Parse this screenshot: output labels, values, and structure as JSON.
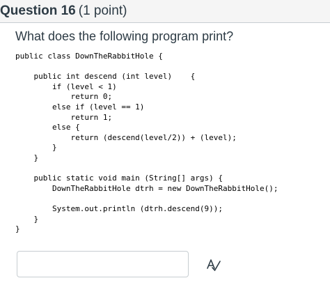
{
  "question": {
    "title": "Question 16",
    "points": "(1 point)",
    "text": "What does the following program print?"
  },
  "code_lines": [
    "public class DownTheRabbitHole {",
    "",
    "    public int descend (int level)    {",
    "        if (level < 1)",
    "            return 0;",
    "        else if (level == 1)",
    "            return 1;",
    "        else {",
    "            return (descend(level/2)) + (level);",
    "        }",
    "    }",
    "",
    "    public static void main (String[] args) {",
    "        DownTheRabbitHole dtrh = new DownTheRabbitHole();",
    "",
    "        System.out.println (dtrh.descend(9));",
    "    }",
    "}"
  ],
  "answer": {
    "value": "",
    "placeholder": ""
  },
  "icons": {
    "spell_check": "spell-check-icon"
  }
}
